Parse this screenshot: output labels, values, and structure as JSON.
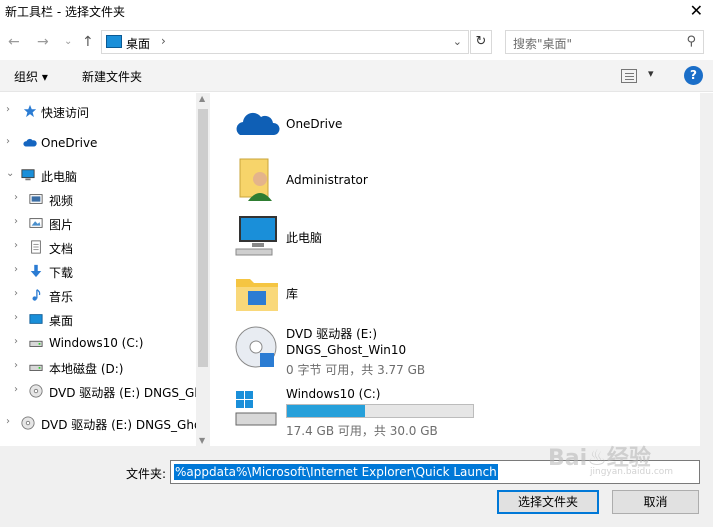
{
  "window": {
    "title": "新工具栏 - 选择文件夹",
    "close_glyph": "✕"
  },
  "navigation": {
    "back_glyph": "←",
    "forward_glyph": "→",
    "recent_glyph": "⌄",
    "up_glyph": "↑",
    "address": "桌面",
    "address_sep": "›",
    "address_dropdown": "⌄",
    "refresh_glyph": "↻",
    "search_placeholder": "搜索\"桌面\"",
    "search_glyph": "⚲"
  },
  "toolbar": {
    "organize_label": "组织 ▾",
    "new_folder_label": "新建文件夹",
    "view_dropdown": "▾",
    "help_glyph": "?"
  },
  "tree": [
    {
      "label": "快速访问",
      "icon": "star-icon",
      "chev": "›"
    },
    {
      "label": "OneDrive",
      "icon": "cloud-icon",
      "chev": "›"
    },
    {
      "label": "此电脑",
      "icon": "computer-icon",
      "chev": "⌄"
    },
    {
      "label": "视频",
      "icon": "video-icon",
      "chev": "›"
    },
    {
      "label": "图片",
      "icon": "picture-icon",
      "chev": "›"
    },
    {
      "label": "文档",
      "icon": "document-icon",
      "chev": "›"
    },
    {
      "label": "下载",
      "icon": "download-icon",
      "chev": "›"
    },
    {
      "label": "音乐",
      "icon": "music-icon",
      "chev": "›"
    },
    {
      "label": "桌面",
      "icon": "desktop-icon",
      "chev": "›"
    },
    {
      "label": "Windows10 (C:)",
      "icon": "drive-icon",
      "chev": "›"
    },
    {
      "label": "本地磁盘 (D:)",
      "icon": "drive-icon",
      "chev": "›"
    },
    {
      "label": "DVD 驱动器 (E:) DNGS_Gh",
      "icon": "dvd-icon",
      "chev": "›"
    },
    {
      "label": "DVD 驱动器 (E:) DNGS_Gho",
      "icon": "dvd-icon",
      "chev": "›"
    }
  ],
  "content": {
    "items": [
      {
        "label": "OneDrive",
        "icon": "onedrive-icon"
      },
      {
        "label": "Administrator",
        "icon": "user-folder-icon"
      },
      {
        "label": "此电脑",
        "icon": "computer-icon"
      },
      {
        "label": "库",
        "icon": "library-icon"
      }
    ],
    "dvd": {
      "label": "DVD 驱动器 (E:)",
      "sub1": "DNGS_Ghost_Win10",
      "sub2": "0 字节 可用，共 3.77 GB",
      "icon": "dvd-icon"
    },
    "drive_c": {
      "label": "Windows10 (C:)",
      "free": "17.4 GB 可用，共 30.0 GB",
      "used_fraction": 0.42,
      "icon": "windows-drive-icon"
    }
  },
  "bottom": {
    "folder_label": "文件夹:",
    "folder_value": "%appdata%\\Microsoft\\Internet Explorer\\Quick Launch",
    "select_button": "选择文件夹",
    "cancel_button": "取消"
  },
  "watermark": {
    "text": "Bai♨经验",
    "sub": "jingyan.baidu.com"
  },
  "colors": {
    "accent": "#0078d7",
    "progress": "#26a0da",
    "toolbar_bg": "#f3f3f3"
  }
}
